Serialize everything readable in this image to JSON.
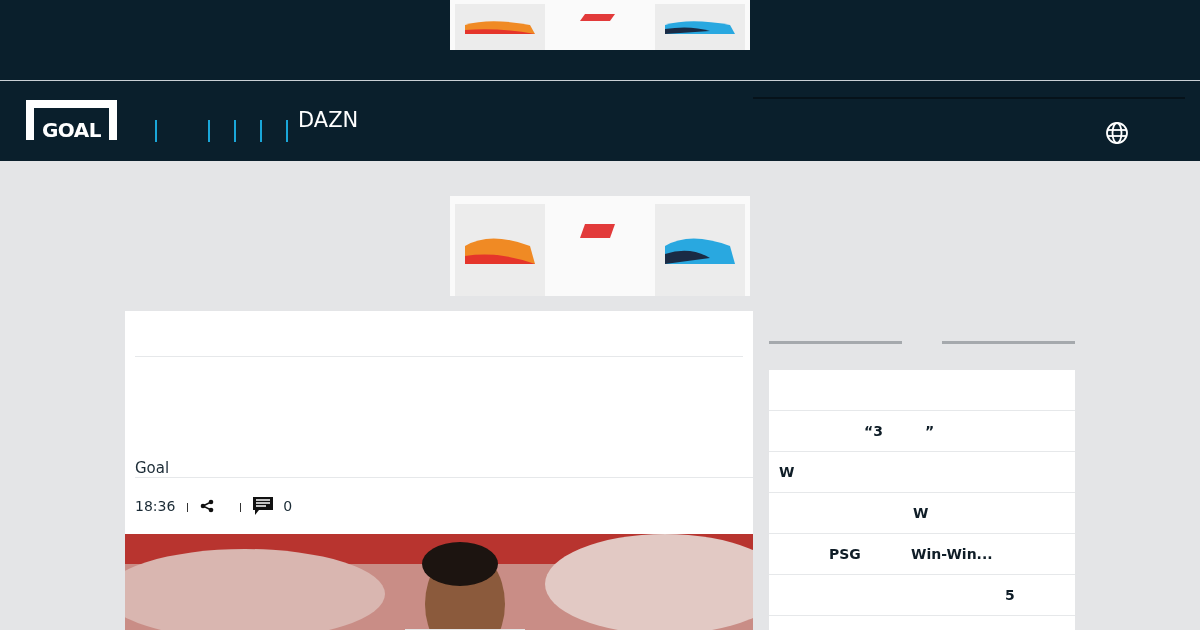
{
  "header": {
    "logo": "GOAL",
    "nav_items": [
      {
        "label": "DAZN"
      }
    ]
  },
  "article": {
    "author": "Goal",
    "time": "18:36",
    "comment_count": "0"
  },
  "sidebar": {
    "rows": [
      {
        "texts": []
      },
      {
        "texts": [
          "“3",
          "”"
        ]
      },
      {
        "texts": [
          "W"
        ]
      },
      {
        "texts": [
          "W"
        ]
      },
      {
        "texts": [
          "PSG",
          "Win-Win..."
        ]
      },
      {
        "texts": [
          "5"
        ]
      },
      {
        "texts": []
      }
    ]
  }
}
